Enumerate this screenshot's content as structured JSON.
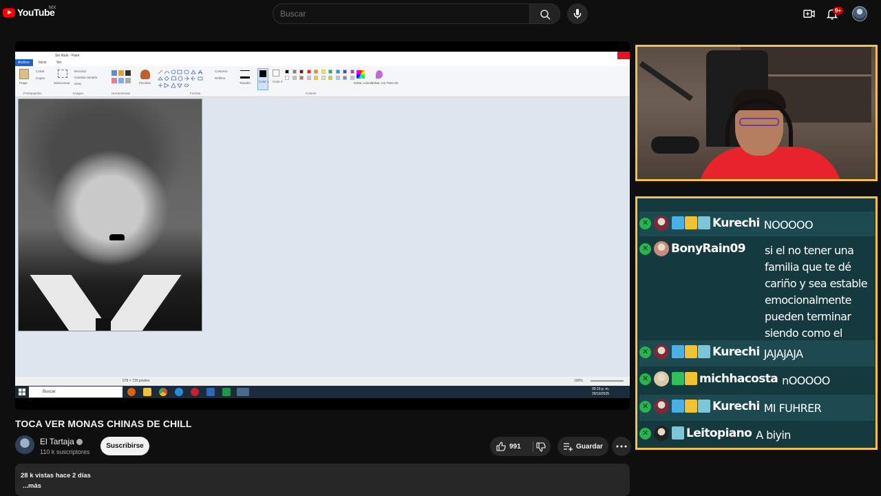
{
  "topbar": {
    "logo_text": "YouTube",
    "region": "MX",
    "search_placeholder": "Buscar",
    "notifications_badge": "9+"
  },
  "paint": {
    "window_title": "Sin título - Paint",
    "tabs": [
      "Archivo",
      "Inicio",
      "Ver"
    ],
    "groups": [
      "Portapapeles",
      "Imagen",
      "Herramientas",
      "Formas",
      "Colores"
    ],
    "tools": [
      "Pegar",
      "Cortar",
      "Copiar",
      "Seleccionar",
      "Recortar",
      "Cambiar tamaño",
      "Girar",
      "Pinceles",
      "Contorno",
      "Relleno",
      "Tamaño",
      "Color 1",
      "Color 2",
      "Editar colores",
      "Editar con Paint 3D"
    ],
    "status_size": "578 × 729 píxeles",
    "zoom": "100%",
    "palette": [
      "#000000",
      "#7f7f7f",
      "#880015",
      "#ed1c24",
      "#ff7f27",
      "#fff200",
      "#22b14c",
      "#00a2e8",
      "#3f48cc",
      "#a349a4",
      "#ffffff",
      "#c3c3c3",
      "#b97a57",
      "#ffaec9",
      "#ffc90e",
      "#efe4b0",
      "#b5e61d",
      "#99d9ea",
      "#7092be",
      "#c8bfe7"
    ]
  },
  "taskbar": {
    "search_placeholder": "Buscar",
    "time": "09:15 p. m.",
    "date": "29/10/2025"
  },
  "video": {
    "title": "TOCA VER MONAS CHINAS DE CHILL",
    "channel": "El Tartaja",
    "subscribers": "110 k suscriptores",
    "subscribe_label": "Suscribirse",
    "likes": "991",
    "save_label": "Guardar",
    "views_date": "28 k vistas  hace 2 días",
    "more_label": "...más"
  },
  "chat": {
    "messages": [
      {
        "user": "Kurechi",
        "text": "NOOOOO",
        "avatar_color": "#7a2a3a",
        "badges": [
          "#4ab0e8",
          "#f2c233",
          "#7cc6d8"
        ]
      },
      {
        "user": "BonyRain09",
        "text": "si el no tener una familia que te dé cariño y sea estable emocionalmente pueden terminar siendo como el mexivergas",
        "avatar_color": "#c88a7a",
        "badges": []
      },
      {
        "user": "Kurechi",
        "text": "JAJAJAJA",
        "avatar_color": "#7a2a3a",
        "badges": [
          "#4ab0e8",
          "#f2c233",
          "#7cc6d8"
        ]
      },
      {
        "user": "michhacosta",
        "text": "nOOOOO",
        "avatar_color": "#d8c8a8",
        "badges": [
          "#2fc05a",
          "#f2c233"
        ]
      },
      {
        "user": "Kurechi",
        "text": "MI FUHRER",
        "avatar_color": "#7a2a3a",
        "badges": [
          "#4ab0e8",
          "#f2c233",
          "#7cc6d8"
        ]
      },
      {
        "user": "Leitopiano",
        "text": "A biyin",
        "avatar_color": "#222222",
        "badges": [
          "#7cc6d8"
        ]
      }
    ]
  }
}
